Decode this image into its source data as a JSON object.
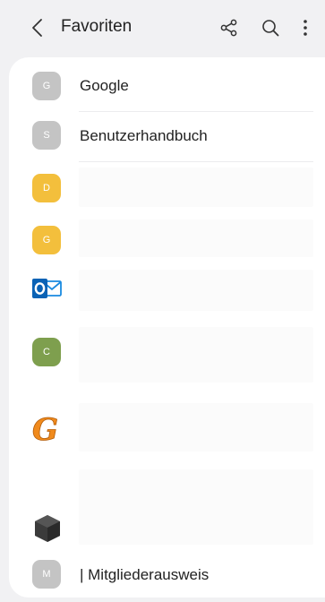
{
  "header": {
    "title": "Favoriten",
    "back_icon": "chevron-left-icon",
    "share_icon": "share-icon",
    "search_icon": "search-icon",
    "more_icon": "more-vertical-icon"
  },
  "items": [
    {
      "initial": "G",
      "label": "Google",
      "color": "#c4c4c4"
    },
    {
      "initial": "S",
      "label": "Benutzerhandbuch",
      "color": "#c4c4c4"
    },
    {
      "initial": "D",
      "label": "",
      "color": "#f3bf3c"
    },
    {
      "initial": "G",
      "label": "",
      "color": "#f3bf3c"
    },
    {
      "icon": "outlook-icon",
      "label": "",
      "color": "#0a6fc2"
    },
    {
      "initial": "C",
      "label": "",
      "color": "#7e9f4e"
    },
    {
      "icon": "gg-logo-icon",
      "label": "",
      "color": "#f08a1c"
    },
    {
      "icon": "cube-icon",
      "label": "",
      "color": "#3a3a3a"
    },
    {
      "initial": "M",
      "label": "| Mitgliederausweis",
      "color": "#c4c4c4"
    }
  ]
}
